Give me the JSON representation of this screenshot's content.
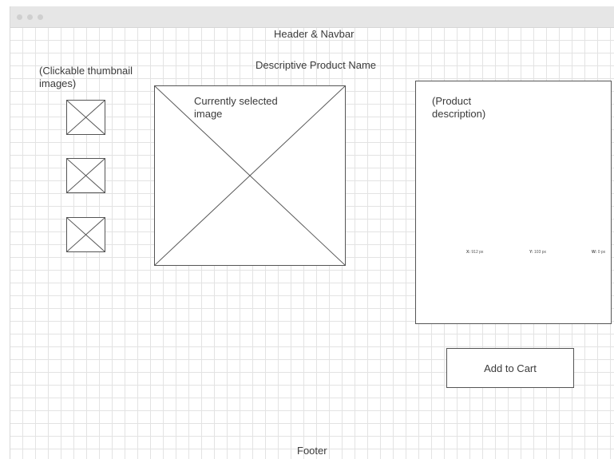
{
  "header": {
    "text": "Header & Navbar"
  },
  "product": {
    "name": "Descriptive Product Name"
  },
  "thumbnails": {
    "label": "(Clickable thumbnail\nimages)",
    "items": [
      {
        "icon": "image-placeholder-icon"
      },
      {
        "icon": "image-placeholder-icon"
      },
      {
        "icon": "image-placeholder-icon"
      }
    ]
  },
  "main_image": {
    "label": "Currently selected\nimage",
    "icon": "image-placeholder-icon"
  },
  "description": {
    "label": "(Product\ndescription)",
    "coords": [
      {
        "key": "X:",
        "value": "912 px"
      },
      {
        "key": "Y:",
        "value": "103 px"
      },
      {
        "key": "W:",
        "value": "0 px"
      }
    ]
  },
  "cart": {
    "button_label": "Add to Cart"
  },
  "footer": {
    "text": "Footer"
  },
  "colors": {
    "grid": "#e3e3e3",
    "stroke": "#555555",
    "titlebar": "#e6e6e6"
  }
}
